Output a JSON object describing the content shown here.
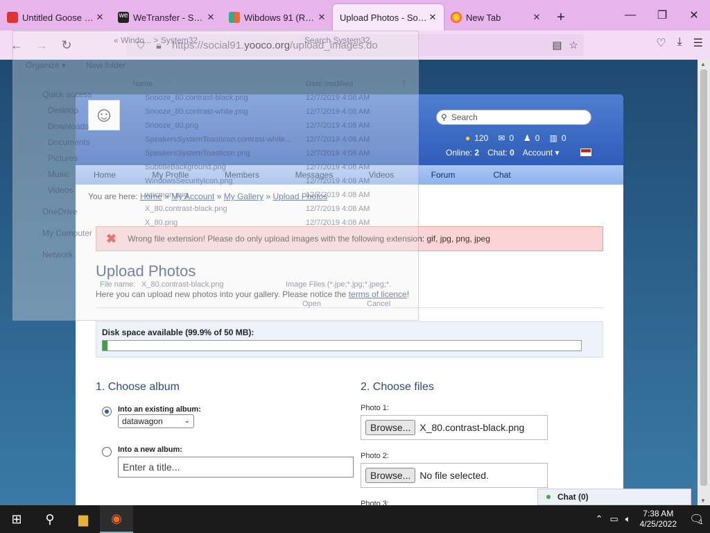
{
  "browser": {
    "tabs": [
      {
        "label": "Untitled Goose Gam",
        "active": false
      },
      {
        "label": "WeTransfer - Send L",
        "active": false
      },
      {
        "label": "Wibdows 91 (REL6 F",
        "active": false
      },
      {
        "label": "Upload Photos - Social9",
        "active": true
      },
      {
        "label": "New Tab",
        "active": false
      }
    ],
    "url_prefix": "https://social91.",
    "url_domain": "yooco.org",
    "url_path": "/upload_images.do"
  },
  "site": {
    "search_placeholder": "Search",
    "stats": {
      "coins": "120",
      "mail": "0",
      "friends": "0",
      "notes": "0"
    },
    "online_label": "Online:",
    "online_count": "2",
    "chat_label": "Chat:",
    "chat_count": "0",
    "account_label": "Account ▾",
    "menu": [
      "Home",
      "My Profile",
      "Members",
      "Messages",
      "Videos",
      "Forum",
      "Chat"
    ],
    "breadcrumb": {
      "prefix": "You are here:",
      "items": [
        "Home",
        "My Account",
        "My Gallery",
        "Upload Photos"
      ],
      "sep": "»"
    },
    "error": "Wrong file extension! Please do only upload images with the following extension: gif, jpg, png, jpeg",
    "heading": "Upload Photos",
    "intro_text": "Here you can upload new photos into your gallery. Please notice the",
    "intro_link": "terms of licence",
    "intro_end": "!",
    "disk_label": "Disk space available (99.9% of 50 MB):",
    "disk_used_fraction": 0.001,
    "choose_album": "1. Choose album",
    "choose_files": "2. Choose files",
    "existing_album_label": "Into an existing album:",
    "existing_album_value": "datawagon",
    "new_album_label": "Into a new album:",
    "new_album_placeholder": "Enter a title...",
    "photos": [
      {
        "label": "Photo 1:",
        "browse": "Browse...",
        "file": "X_80.contrast-black.png"
      },
      {
        "label": "Photo 2:",
        "browse": "Browse...",
        "file": "No file selected."
      },
      {
        "label": "Photo 3:"
      }
    ],
    "chat_widget": "Chat (0)"
  },
  "ghost_dialog": {
    "toolbar": [
      "Organize ▾",
      "New folder"
    ],
    "nav": [
      "Quick access",
      "Desktop",
      "Downloads",
      "Documents",
      "Pictures",
      "Music",
      "Videos",
      "OneDrive",
      "My Computer",
      "Network"
    ],
    "columns": [
      "Name",
      "Date modified",
      "T"
    ],
    "files": [
      {
        "name": "Snooze_80.contrast-black.png",
        "date": "12/7/2019 4:08 AM"
      },
      {
        "name": "Snooze_80.contrast-white.png",
        "date": "12/7/2019 4:08 AM"
      },
      {
        "name": "Snooze_80.png",
        "date": "12/7/2019 4:08 AM"
      },
      {
        "name": "SpeakersSystemToastIcon.contrast-white...",
        "date": "12/7/2019 4:08 AM"
      },
      {
        "name": "SpeakersSystemToastIcon.png",
        "date": "12/7/2019 4:08 AM"
      },
      {
        "name": "SubtitleBackground.png",
        "date": "12/7/2019 4:08 AM"
      },
      {
        "name": "WindowsSecurityIcon.png",
        "date": "12/7/2019 4:08 AM"
      },
      {
        "name": "wpcmon.png",
        "date": "12/7/2019 4:08 AM"
      },
      {
        "name": "X_80.contrast-black.png",
        "date": "12/7/2019 4:08 AM"
      },
      {
        "name": "X_80.png",
        "date": "12/7/2019 4:08 AM"
      }
    ],
    "search_placeholder": "Search System32",
    "breadcrumb": "« Windo... > System32",
    "filename_label": "File name:",
    "filename_value": "X_80.contrast-black.png",
    "filter": "Image Files (*.jpe;*.jpg;*.jpeg;*.",
    "open": "Open",
    "cancel": "Cancel"
  },
  "taskbar": {
    "time": "7:38 AM",
    "date": "4/25/2022",
    "notif_count": "1"
  }
}
